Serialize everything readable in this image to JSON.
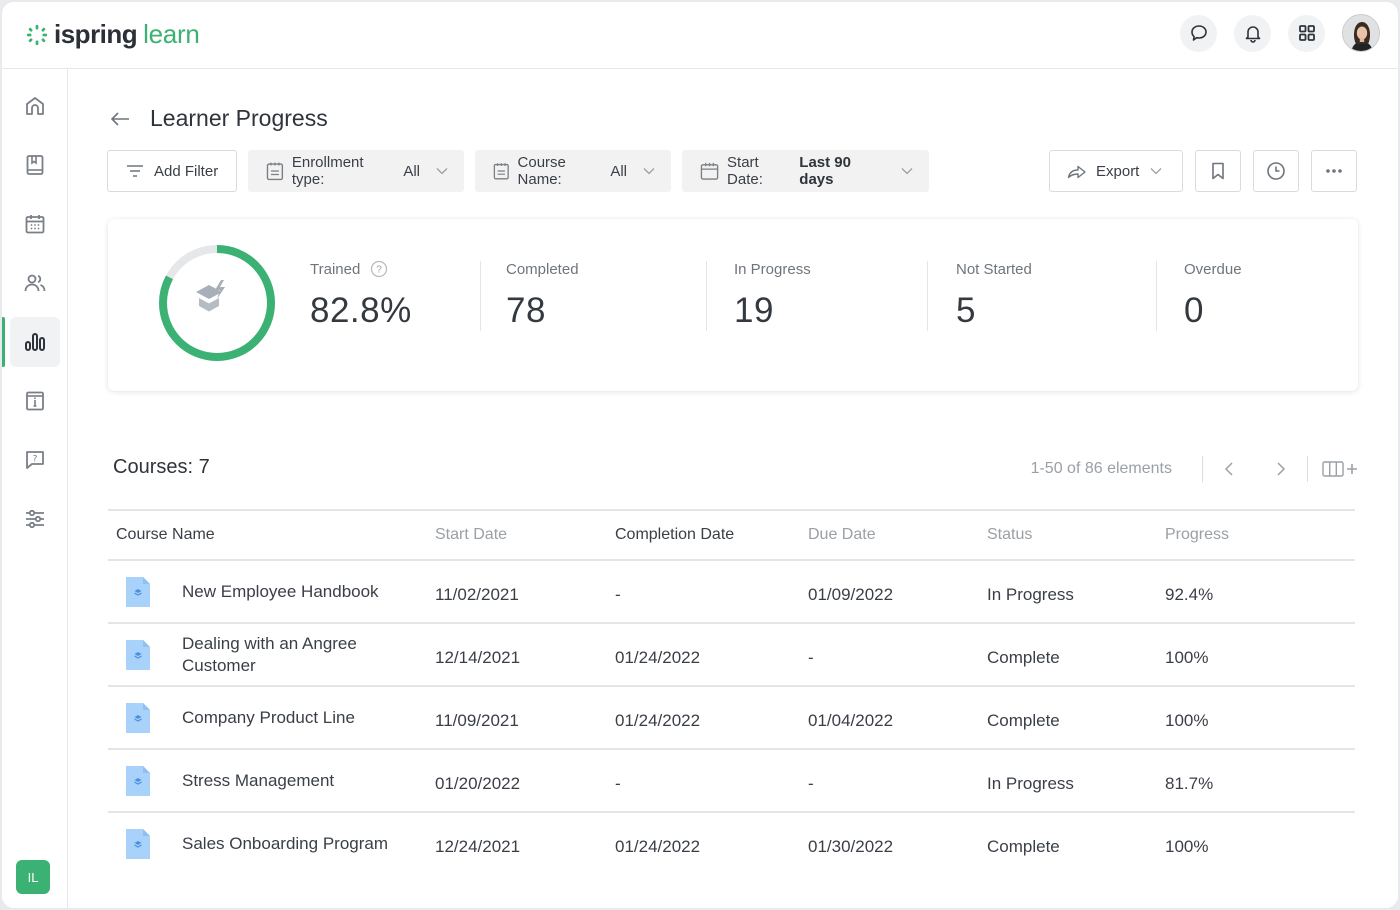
{
  "app": {
    "logo_primary": "ispring",
    "logo_secondary": "learn",
    "brand_color": "#3bb273"
  },
  "header": {
    "icons": [
      "chat-icon",
      "bell-icon",
      "apps-grid-icon"
    ],
    "avatar_alt": "User avatar"
  },
  "sidebar": {
    "items": [
      {
        "name": "home",
        "icon": "home-icon",
        "active": false
      },
      {
        "name": "library",
        "icon": "book-icon",
        "active": false
      },
      {
        "name": "calendar",
        "icon": "calendar-icon",
        "active": false
      },
      {
        "name": "users",
        "icon": "users-icon",
        "active": false
      },
      {
        "name": "reports",
        "icon": "bar-chart-icon",
        "active": true
      },
      {
        "name": "info",
        "icon": "info-page-icon",
        "active": false
      },
      {
        "name": "help",
        "icon": "question-chat-icon",
        "active": false
      },
      {
        "name": "settings",
        "icon": "sliders-icon",
        "active": false
      }
    ],
    "user_initials": "IL"
  },
  "page": {
    "title": "Learner Progress"
  },
  "filters": {
    "add_filter": "Add Filter",
    "enrollment_label": "Enrollment type:",
    "enrollment_value": "All",
    "course_label": "Course Name:",
    "course_value": "All",
    "start_label": "Start Date:",
    "start_value": "Last 90 days"
  },
  "actions": {
    "export": "Export"
  },
  "stats": {
    "trained_label": "Trained",
    "trained_value": "82.8%",
    "trained_fraction": 0.828,
    "completed_label": "Completed",
    "completed_value": "78",
    "in_progress_label": "In Progress",
    "in_progress_value": "19",
    "not_started_label": "Not Started",
    "not_started_value": "5",
    "overdue_label": "Overdue",
    "overdue_value": "0",
    "ring_color": "#3bb273",
    "track_color": "#e6e7e9"
  },
  "courses": {
    "heading": "Courses: 7",
    "pagination": "1-50 of 86 elements",
    "columns": [
      "Course Name",
      "Start Date",
      "Completion Date",
      "Due Date",
      "Status",
      "Progress"
    ],
    "rows": [
      {
        "name": "New Employee Handbook",
        "start": "11/02/2021",
        "completion": "-",
        "due": "01/09/2022",
        "status": "In Progress",
        "progress": "92.4%"
      },
      {
        "name": "Dealing with an Angree Customer",
        "start": "12/14/2021",
        "completion": "01/24/2022",
        "due": "-",
        "status": "Complete",
        "progress": "100%"
      },
      {
        "name": "Company Product Line",
        "start": "11/09/2021",
        "completion": "01/24/2022",
        "due": "01/04/2022",
        "status": "Complete",
        "progress": "100%"
      },
      {
        "name": "Stress Management",
        "start": "01/20/2022",
        "completion": "-",
        "due": "-",
        "status": "In Progress",
        "progress": "81.7%"
      },
      {
        "name": "Sales Onboarding Program",
        "start": "12/24/2021",
        "completion": "01/24/2022",
        "due": "01/30/2022",
        "status": "Complete",
        "progress": "100%"
      }
    ]
  }
}
